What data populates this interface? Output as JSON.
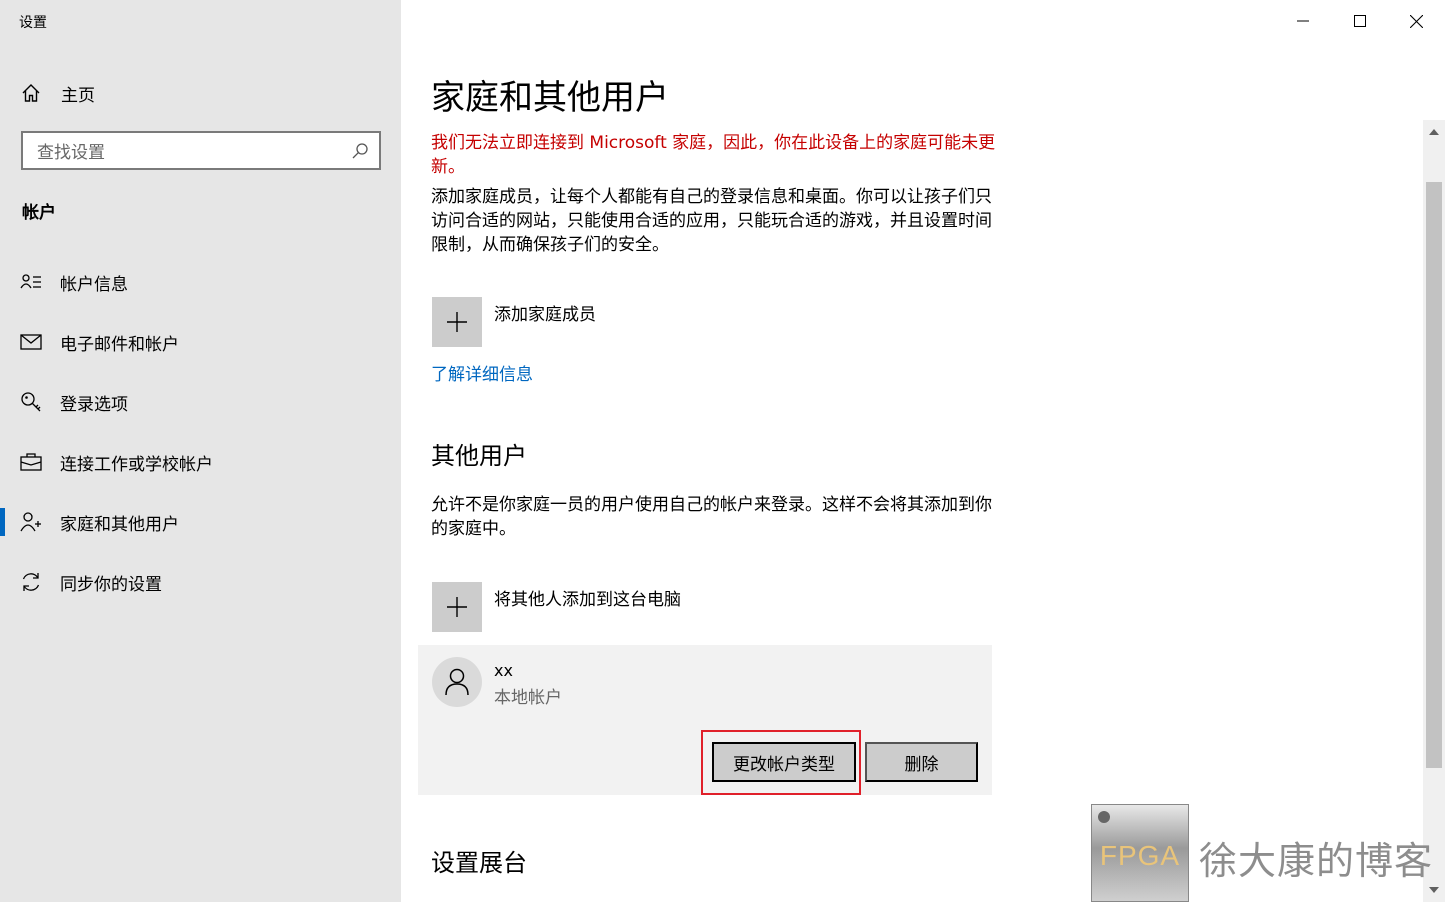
{
  "window": {
    "title": "设置"
  },
  "sidebar": {
    "home_label": "主页",
    "search_placeholder": "查找设置",
    "section_title": "帐户",
    "items": [
      {
        "label": "帐户信息",
        "icon": "account-info-icon"
      },
      {
        "label": "电子邮件和帐户",
        "icon": "mail-icon"
      },
      {
        "label": "登录选项",
        "icon": "key-icon"
      },
      {
        "label": "连接工作或学校帐户",
        "icon": "briefcase-icon"
      },
      {
        "label": "家庭和其他用户",
        "icon": "family-icon",
        "active": true
      },
      {
        "label": "同步你的设置",
        "icon": "sync-icon"
      }
    ]
  },
  "main": {
    "title": "家庭和其他用户",
    "warning": "我们无法立即连接到 Microsoft 家庭，因此，你在此设备上的家庭可能未更新。",
    "family_description": "添加家庭成员，让每个人都能有自己的登录信息和桌面。你可以让孩子们只访问合适的网站，只能使用合适的应用，只能玩合适的游戏，并且设置时间限制，从而确保孩子们的安全。",
    "add_family_label": "添加家庭成员",
    "learn_more": "了解详细信息",
    "other_users_heading": "其他用户",
    "other_users_description": "允许不是你家庭一员的用户使用自己的帐户来登录。这样不会将其添加到你的家庭中。",
    "add_other_label": "将其他人添加到这台电脑",
    "user": {
      "name": "xx",
      "type": "本地帐户",
      "change_type_label": "更改帐户类型",
      "delete_label": "删除"
    },
    "kiosk_heading": "设置展台"
  },
  "watermark": {
    "logo_text": "FPGA",
    "text": "徐大康的博客"
  },
  "colors": {
    "sidebar_bg": "#e6e6e6",
    "accent": "#0067c0",
    "warning": "#c50000",
    "highlight": "#e0202a",
    "button_bg": "#cccccc"
  }
}
